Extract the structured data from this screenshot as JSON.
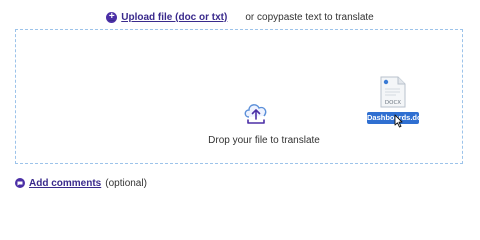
{
  "upload": {
    "link_label": "Upload file (doc or txt)",
    "alt_text": "or copypaste text to translate"
  },
  "dropzone": {
    "label": "Drop your file to translate"
  },
  "drag_file": {
    "icon_label": "DOCX",
    "name": "Dashboards.docx"
  },
  "comments": {
    "link_label": "Add comments",
    "optional_label": "(optional)"
  },
  "colors": {
    "accent": "#4b2fa6",
    "drop_border": "#9cc3ea",
    "file_badge": "#2f6fd1"
  }
}
